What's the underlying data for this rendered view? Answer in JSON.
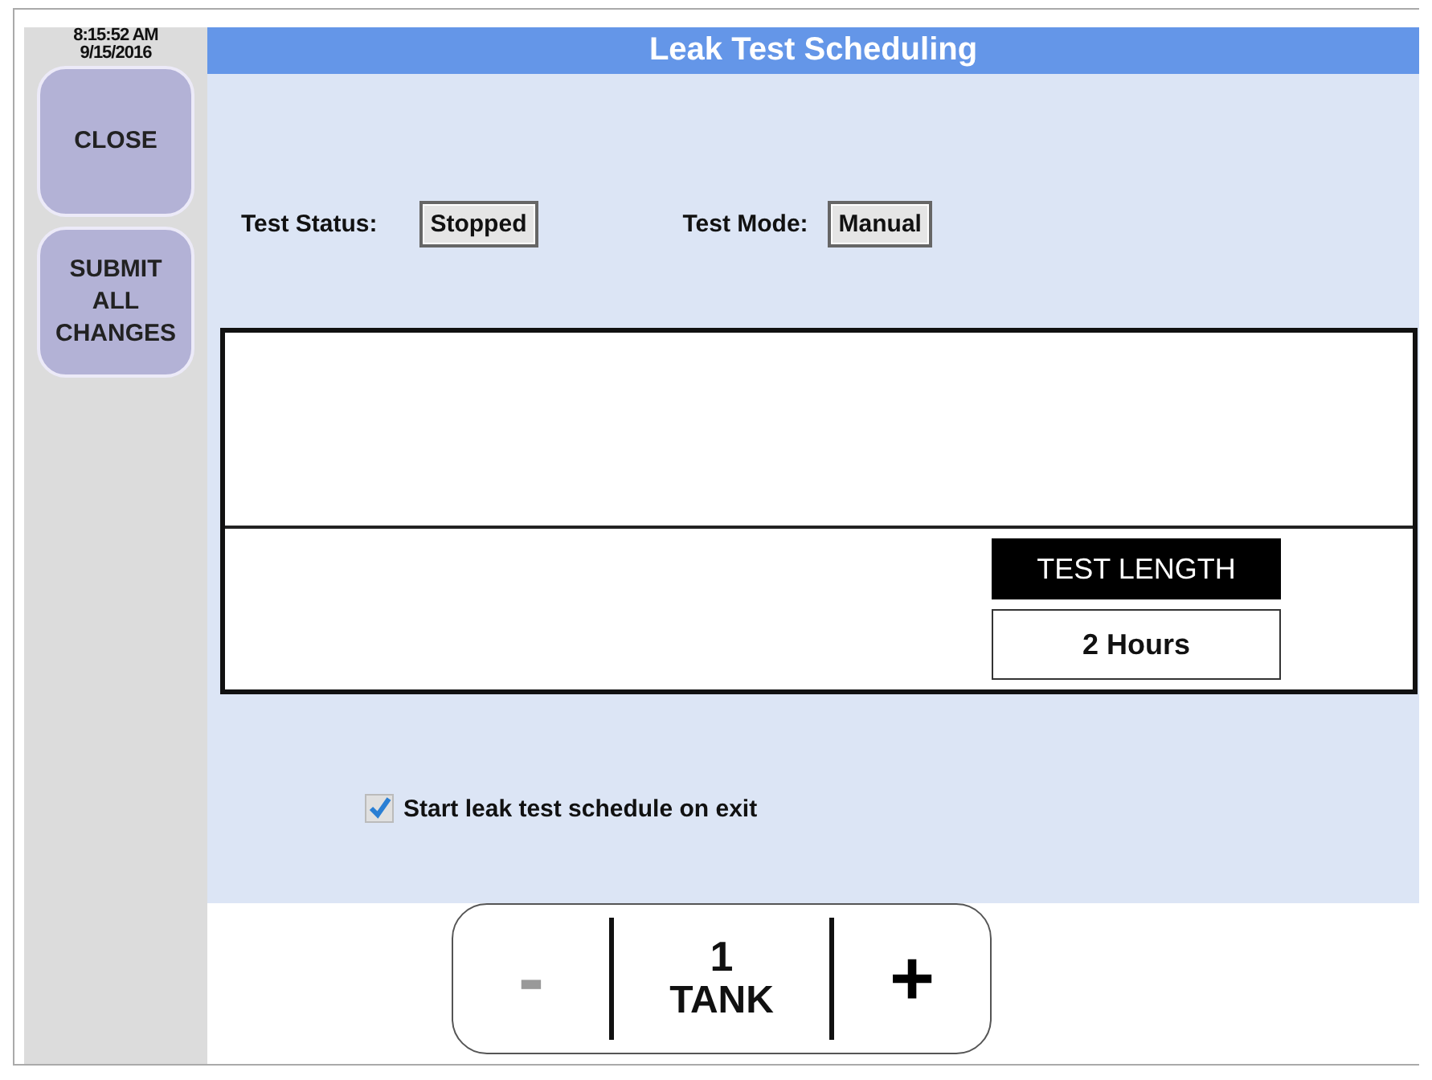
{
  "clock": {
    "time": "8:15:52 AM",
    "date": "9/15/2016"
  },
  "sidebar": {
    "buttons": [
      {
        "label": "CLOSE"
      },
      {
        "label": "SUBMIT ALL CHANGES"
      }
    ]
  },
  "header": {
    "title": "Leak Test Scheduling"
  },
  "status": [
    {
      "label": "Test Status:",
      "value": "Stopped"
    },
    {
      "label": "Test Mode:",
      "value": "Manual"
    }
  ],
  "test_length": {
    "label": "TEST LENGTH",
    "value": "2 Hours"
  },
  "schedule_checkbox": {
    "label": "Start leak test schedule on exit",
    "checked": true
  },
  "tank_stepper": {
    "minus": {
      "label": "-",
      "disabled": true
    },
    "count": "1",
    "unit": "TANK",
    "plus": {
      "label": "+",
      "disabled": false
    }
  }
}
